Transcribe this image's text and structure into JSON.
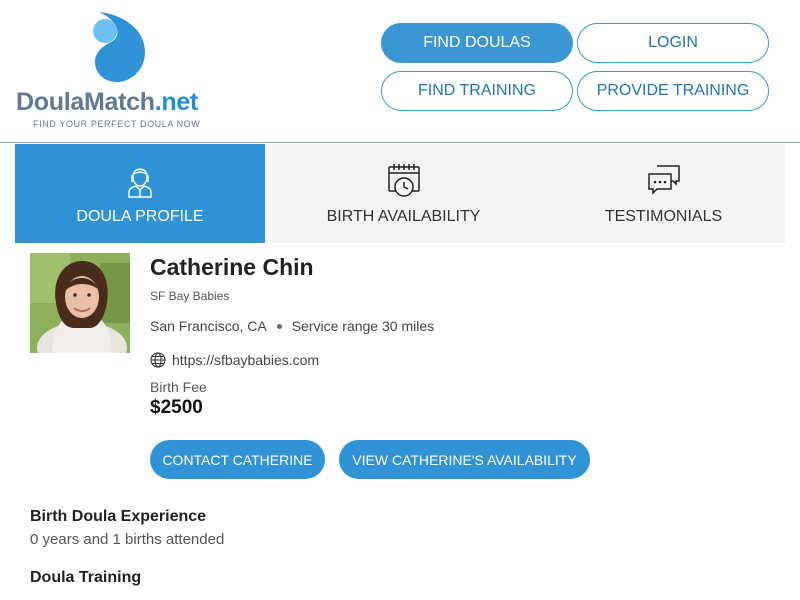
{
  "logo": {
    "doula": "Doula",
    "match": "Match",
    "net": ".net",
    "tagline": "FIND YOUR PERFECT DOULA NOW",
    "brand_color": "#1f8fd6"
  },
  "nav": {
    "find_doulas": "FIND DOULAS",
    "login": "LOGIN",
    "find_training": "FIND TRAINING",
    "provide_training": "PROVIDE TRAINING"
  },
  "tabs": [
    {
      "label": "DOULA PROFILE",
      "icon": "profile-icon",
      "active": true
    },
    {
      "label": "BIRTH AVAILABILITY",
      "icon": "calendar-clock-icon",
      "active": false
    },
    {
      "label": "TESTIMONIALS",
      "icon": "chat-bubbles-icon",
      "active": false
    }
  ],
  "profile": {
    "name": "Catherine Chin",
    "organization": "SF Bay Babies",
    "location": "San Francisco, CA",
    "service_range": "Service range 30 miles",
    "website": "https://sfbaybabies.com",
    "fee_label": "Birth Fee",
    "fee": "$2500",
    "contact_button": "CONTACT CATHERINE",
    "availability_button": "VIEW CATHERINE'S AVAILABILITY"
  },
  "sections": {
    "experience_title": "Birth Doula Experience",
    "experience_text": "0 years and 1 births attended",
    "training_title": "Doula Training"
  },
  "colors": {
    "accent": "#2f93d5",
    "tab_bg": "#f4f4f4"
  }
}
